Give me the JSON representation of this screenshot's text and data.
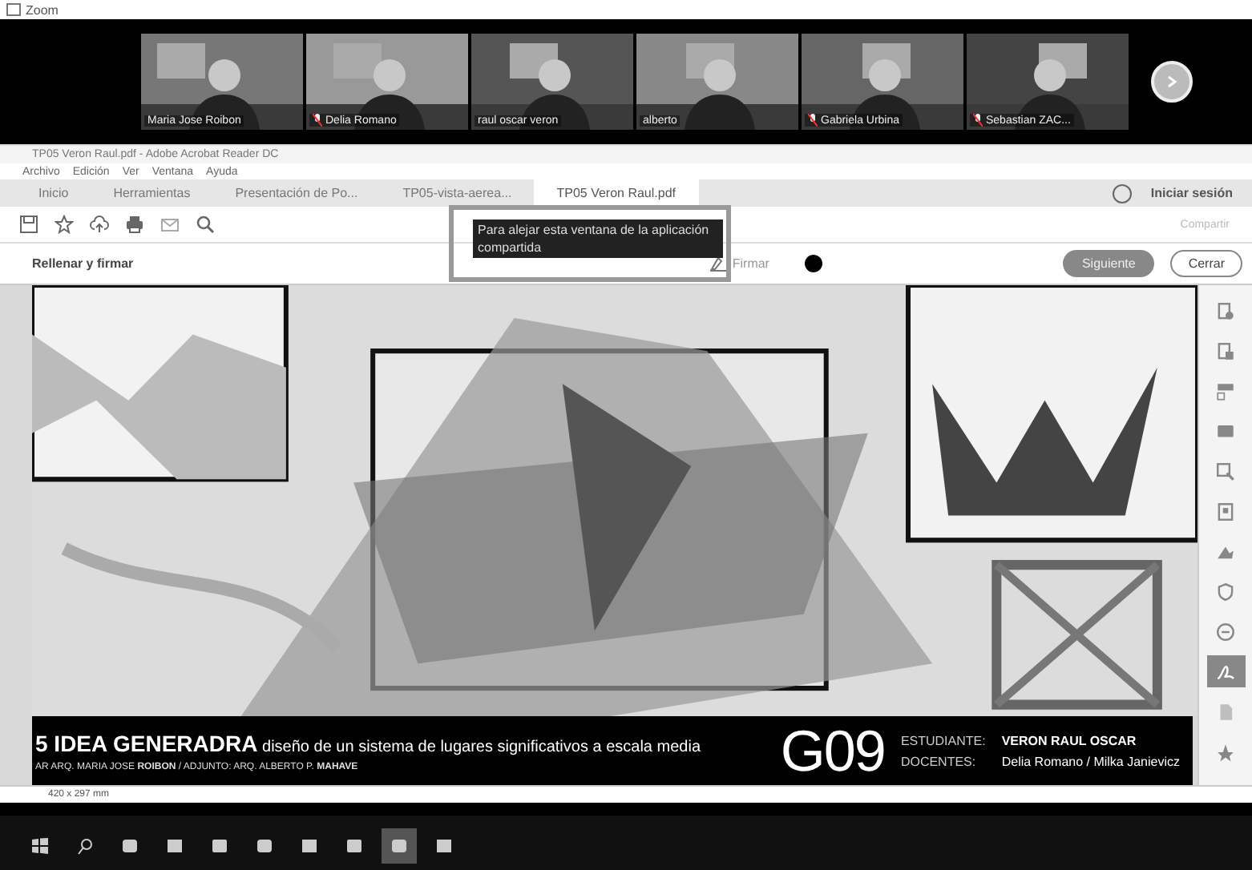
{
  "zoom_window": {
    "title": "Zoom"
  },
  "participants": [
    {
      "name": "Maria Jose Roibon",
      "muted": false
    },
    {
      "name": "Delia Romano",
      "muted": true
    },
    {
      "name": "raul oscar veron",
      "muted": false
    },
    {
      "name": "alberto",
      "muted": false
    },
    {
      "name": "Gabriela Urbina",
      "muted": true
    },
    {
      "name": "Sebastian ZAC...",
      "muted": true
    }
  ],
  "acrobat": {
    "title": "TP05 Veron Raul.pdf - Adobe Acrobat Reader DC",
    "menu": [
      "Archivo",
      "Edición",
      "Ver",
      "Ventana",
      "Ayuda"
    ],
    "tabs": [
      {
        "label": "Inicio",
        "selected": false
      },
      {
        "label": "Herramientas",
        "selected": false
      },
      {
        "label": "Presentación de Po...",
        "selected": false
      },
      {
        "label": "TP05-vista-aerea...",
        "selected": false
      },
      {
        "label": "TP05 Veron Raul.pdf",
        "selected": true
      }
    ],
    "sign_in": "Iniciar sesión",
    "share": "Compartir",
    "fill_sign": {
      "title": "Rellenar y firmar",
      "sign": "Firmar",
      "next": "Siguiente",
      "close": "Cerrar"
    },
    "overlay": "Para alejar esta ventana de la aplicación compartida",
    "banner": {
      "title": "5 IDEA GENERADRA",
      "subtitle": "diseño de un sistema de lugares significativos a escala media",
      "staff": "AR ARQ. MARIA JOSE **ROIBON** / ADJUNTO: ARQ. ALBERTO P. **MAHAVE**",
      "group": "G09",
      "student_label": "ESTUDIANTE:",
      "student": "VERON RAUL OSCAR",
      "teachers_label": "DOCENTES:",
      "teachers": "Delia Romano / Milka Janievicz"
    },
    "page_size": "420 x 297 mm",
    "tools": [
      {
        "selected": false
      },
      {
        "selected": false
      },
      {
        "selected": false
      },
      {
        "selected": false
      },
      {
        "selected": false
      },
      {
        "selected": false
      },
      {
        "selected": false
      },
      {
        "selected": false
      },
      {
        "selected": false
      },
      {
        "selected": true
      },
      {
        "selected": false
      },
      {
        "selected": false
      }
    ]
  },
  "taskbar": [
    {
      "selected": false
    },
    {
      "selected": false
    },
    {
      "selected": false
    },
    {
      "selected": false
    },
    {
      "selected": false
    },
    {
      "selected": false
    },
    {
      "selected": false
    },
    {
      "selected": false
    },
    {
      "selected": true
    },
    {
      "selected": false
    }
  ]
}
